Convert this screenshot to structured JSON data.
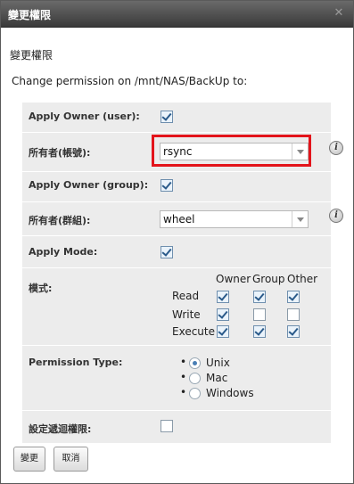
{
  "dialog": {
    "title": "變更權限",
    "close_glyph": "✕",
    "subtitle": "變更權限",
    "description": "Change permission on /mnt/NAS/BackUp to:"
  },
  "form": {
    "apply_owner_user": {
      "label": "Apply Owner (user):",
      "checked": true
    },
    "owner_user": {
      "label": "所有者(帳號):",
      "value": "rsync",
      "info_icon": "info-icon"
    },
    "apply_owner_group": {
      "label": "Apply Owner (group):",
      "checked": true
    },
    "owner_group": {
      "label": "所有者(群組):",
      "value": "wheel",
      "info_icon": "info-icon"
    },
    "apply_mode": {
      "label": "Apply Mode:",
      "checked": true
    },
    "mode": {
      "label": "模式:",
      "columns": [
        "Owner",
        "Group",
        "Other"
      ],
      "rows": [
        {
          "label": "Read",
          "values": [
            true,
            true,
            true
          ]
        },
        {
          "label": "Write",
          "values": [
            true,
            false,
            false
          ]
        },
        {
          "label": "Execute",
          "values": [
            true,
            true,
            true
          ]
        }
      ]
    },
    "permission_type": {
      "label": "Permission Type:",
      "options": [
        "Unix",
        "Mac",
        "Windows"
      ],
      "selected": "Unix"
    },
    "recursive": {
      "label": "設定遞迴權限:",
      "checked": false
    }
  },
  "buttons": {
    "submit": "變更",
    "cancel": "取消"
  },
  "colors": {
    "highlight": "#e3141b",
    "row_bg": "#ececec",
    "titlebar": "#4a4a4a"
  }
}
